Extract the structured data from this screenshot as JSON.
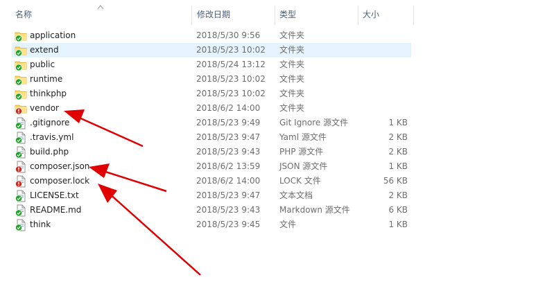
{
  "header": {
    "name": "名称",
    "date": "修改日期",
    "type": "类型",
    "size": "大小"
  },
  "rows": [
    {
      "name": "application",
      "date": "2018/5/30 9:56",
      "type": "文件夹",
      "size": "",
      "icon": "folder-synced-icon"
    },
    {
      "name": "extend",
      "date": "2018/5/23 10:02",
      "type": "文件夹",
      "size": "",
      "icon": "folder-synced-icon",
      "selected": true
    },
    {
      "name": "public",
      "date": "2018/5/24 13:12",
      "type": "文件夹",
      "size": "",
      "icon": "folder-synced-icon"
    },
    {
      "name": "runtime",
      "date": "2018/5/23 10:02",
      "type": "文件夹",
      "size": "",
      "icon": "folder-synced-icon"
    },
    {
      "name": "thinkphp",
      "date": "2018/5/23 10:02",
      "type": "文件夹",
      "size": "",
      "icon": "folder-synced-icon"
    },
    {
      "name": "vendor",
      "date": "2018/6/2 14:00",
      "type": "文件夹",
      "size": "",
      "icon": "folder-conflict-icon"
    },
    {
      "name": ".gitignore",
      "date": "2018/5/23 9:49",
      "type": "Git Ignore 源文件",
      "size": "1 KB",
      "icon": "file-synced-icon"
    },
    {
      "name": ".travis.yml",
      "date": "2018/5/23 9:47",
      "type": "Yaml 源文件",
      "size": "2 KB",
      "icon": "file-synced-icon"
    },
    {
      "name": "build.php",
      "date": "2018/5/23 9:43",
      "type": "PHP 源文件",
      "size": "2 KB",
      "icon": "file-synced-icon"
    },
    {
      "name": "composer.json",
      "date": "2018/6/2 13:59",
      "type": "JSON 源文件",
      "size": "1 KB",
      "icon": "file-conflict-icon"
    },
    {
      "name": "composer.lock",
      "date": "2018/6/2 14:00",
      "type": "LOCK 文件",
      "size": "56 KB",
      "icon": "file-conflict-icon"
    },
    {
      "name": "LICENSE.txt",
      "date": "2018/5/23 9:47",
      "type": "文本文档",
      "size": "2 KB",
      "icon": "file-synced-icon"
    },
    {
      "name": "README.md",
      "date": "2018/5/23 9:43",
      "type": "Markdown 源文件",
      "size": "6 KB",
      "icon": "file-synced-icon"
    },
    {
      "name": "think",
      "date": "2018/5/23 9:45",
      "type": "文件",
      "size": "1 KB",
      "icon": "file-synced-icon"
    }
  ],
  "colors": {
    "selection": "#e5f3ff",
    "synced_badge": "#1aa523",
    "conflict_badge": "#d0281d",
    "folder": "#ffd25e",
    "annotation_arrow": "#e00000"
  }
}
